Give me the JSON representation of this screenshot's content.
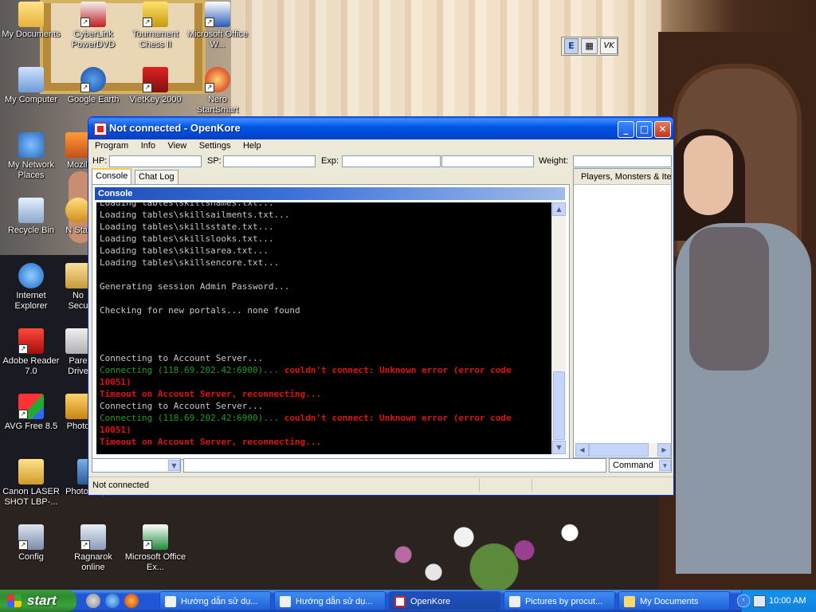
{
  "desktop": {
    "icons": [
      {
        "label": "My Documents"
      },
      {
        "label": "CyberLink PowerDVD"
      },
      {
        "label": "Tournament Chess II"
      },
      {
        "label": "Microsoft Office W..."
      },
      {
        "label": "My Computer"
      },
      {
        "label": "Google Earth"
      },
      {
        "label": "VietKey 2000"
      },
      {
        "label": "Nero StartSmart"
      },
      {
        "label": "My Network Places"
      },
      {
        "label": "Recycle Bin"
      },
      {
        "label": "Internet Explorer"
      },
      {
        "label": "Adobe Reader 7.0"
      },
      {
        "label": "AVG Free 8.5"
      },
      {
        "label": "Canon LASER SHOT LBP-..."
      },
      {
        "label": "Config"
      },
      {
        "label": "Ragnarok online"
      },
      {
        "label": "Microsoft Office Ex..."
      }
    ],
    "partial_labels": [
      "Mozill",
      "N Star",
      "No Secu",
      "Pare Drive",
      "Photo",
      "Photoshop 8"
    ]
  },
  "language_bar": {
    "items": [
      "E",
      "VK"
    ]
  },
  "window": {
    "title": "Not connected - OpenKore",
    "menu": [
      "Program",
      "Info",
      "View",
      "Settings",
      "Help"
    ],
    "stats": {
      "hp_label": "HP:",
      "sp_label": "SP:",
      "exp_label": "Exp:",
      "weight_label": "Weight:"
    },
    "tabs": [
      "Console",
      "Chat Log"
    ],
    "console_header": "Console",
    "console_lines": [
      {
        "text": "Loading tables\\skillsnames.txt...",
        "color": "white"
      },
      {
        "text": "Loading tables\\skillsailments.txt...",
        "color": "white"
      },
      {
        "text": "Loading tables\\skillsstate.txt...",
        "color": "white"
      },
      {
        "text": "Loading tables\\skillslooks.txt...",
        "color": "white"
      },
      {
        "text": "Loading tables\\skillsarea.txt...",
        "color": "white"
      },
      {
        "text": "Loading tables\\skillsencore.txt...",
        "color": "white"
      },
      {
        "text": "",
        "color": "white"
      },
      {
        "text": "Generating session Admin Password...",
        "color": "white"
      },
      {
        "text": "",
        "color": "white"
      },
      {
        "text": "Checking for new portals... none found",
        "color": "white"
      },
      {
        "text": "",
        "color": "white"
      },
      {
        "text": "",
        "color": "white"
      },
      {
        "text": "",
        "color": "white"
      },
      {
        "text": "Connecting to Account Server...",
        "color": "white"
      },
      {
        "parts": [
          {
            "text": "Connecting (118.69.202.42:6900)... ",
            "color": "green"
          },
          {
            "text": "couldn't connect: Unknown error (error code",
            "color": "red"
          }
        ]
      },
      {
        "text": "10051)",
        "color": "red"
      },
      {
        "text": "Timeout on Account Server, reconnecting...",
        "color": "red"
      },
      {
        "text": "Connecting to Account Server...",
        "color": "white"
      },
      {
        "parts": [
          {
            "text": "Connecting (118.69.202.42:6900)... ",
            "color": "green"
          },
          {
            "text": "couldn't connect: Unknown error (error code",
            "color": "red"
          }
        ]
      },
      {
        "text": "10051)",
        "color": "red"
      },
      {
        "text": "Timeout on Account Server, reconnecting...",
        "color": "red"
      }
    ],
    "right_panel_title": "Players, Monsters & Ite",
    "command_mode": "Command",
    "status": "Not connected"
  },
  "taskbar": {
    "start_label": "start",
    "items": [
      {
        "label": "Hướng dẫn sử dụ...",
        "active": false
      },
      {
        "label": "Hướng dẫn sử dụ...",
        "active": false
      },
      {
        "label": "OpenKore",
        "active": true
      },
      {
        "label": "Pictures by procut...",
        "active": false
      },
      {
        "label": "My Documents",
        "active": false
      }
    ],
    "clock": "10:00 AM"
  },
  "colors": {
    "console_bg": "#000000",
    "console_text": "#c8c8c8",
    "console_green": "#1c9e1c",
    "console_red": "#e01010",
    "title_blue": "#0054e3"
  }
}
